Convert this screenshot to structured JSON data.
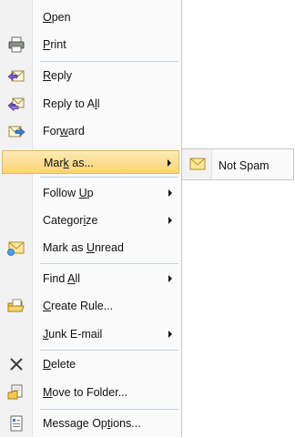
{
  "menu": {
    "items": [
      {
        "id": "open",
        "pre": "",
        "key": "O",
        "post": "pen",
        "icon": "",
        "submenu": false
      },
      {
        "id": "print",
        "pre": "",
        "key": "P",
        "post": "rint",
        "icon": "printer-icon",
        "submenu": false
      },
      {
        "id": "reply",
        "pre": "",
        "key": "R",
        "post": "eply",
        "icon": "reply-icon",
        "submenu": false
      },
      {
        "id": "reply-all",
        "pre": "Reply to A",
        "key": "l",
        "post": "l",
        "icon": "reply-all-icon",
        "submenu": false
      },
      {
        "id": "forward",
        "pre": "For",
        "key": "w",
        "post": "ard",
        "icon": "forward-icon",
        "submenu": false
      },
      {
        "id": "mark-as",
        "pre": "Mar",
        "key": "k",
        "post": " as...",
        "icon": "",
        "submenu": true
      },
      {
        "id": "follow-up",
        "pre": "Follow ",
        "key": "U",
        "post": "p",
        "icon": "",
        "submenu": true
      },
      {
        "id": "categorize",
        "pre": "Categor",
        "key": "i",
        "post": "ze",
        "icon": "",
        "submenu": true
      },
      {
        "id": "mark-unread",
        "pre": "Mark as ",
        "key": "U",
        "post": "nread",
        "icon": "envelope-unread-icon",
        "submenu": false
      },
      {
        "id": "find-all",
        "pre": "Find ",
        "key": "A",
        "post": "ll",
        "icon": "",
        "submenu": true
      },
      {
        "id": "create-rule",
        "pre": "",
        "key": "C",
        "post": "reate Rule...",
        "icon": "rules-icon",
        "submenu": false
      },
      {
        "id": "junk-email",
        "pre": "",
        "key": "J",
        "post": "unk E-mail",
        "icon": "",
        "submenu": true
      },
      {
        "id": "delete",
        "pre": "",
        "key": "D",
        "post": "elete",
        "icon": "delete-icon",
        "submenu": false
      },
      {
        "id": "move-to-folder",
        "pre": "",
        "key": "M",
        "post": "ove to Folder...",
        "icon": "move-folder-icon",
        "submenu": false
      },
      {
        "id": "message-options",
        "pre": "Message Op",
        "key": "t",
        "post": "ions...",
        "icon": "message-options-icon",
        "submenu": false
      }
    ],
    "highlighted": "mark-as"
  },
  "submenu": {
    "item_label": "Not Spam",
    "item_icon": "envelope-icon"
  }
}
